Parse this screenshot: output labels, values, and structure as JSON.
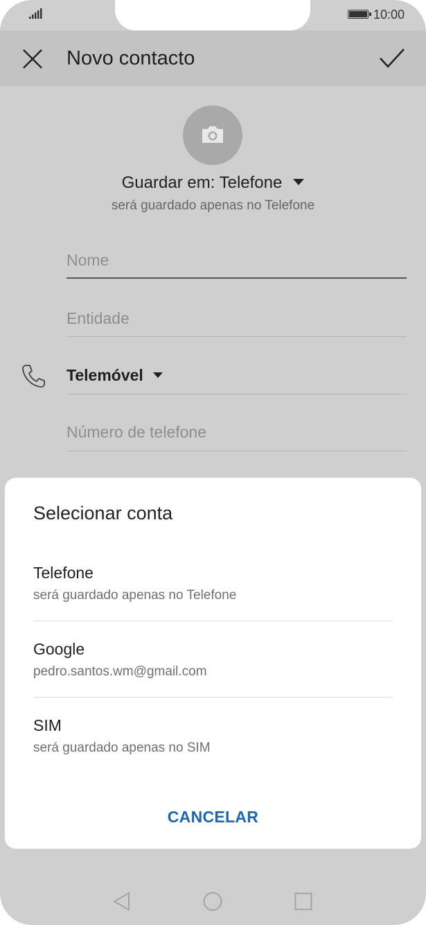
{
  "status": {
    "time": "10:00"
  },
  "appbar": {
    "title": "Novo contacto"
  },
  "save": {
    "label": "Guardar em: Telefone",
    "sub": "será guardado apenas no Telefone"
  },
  "fields": {
    "name_placeholder": "Nome",
    "entity_placeholder": "Entidade",
    "phone_type": "Telemóvel",
    "phone_placeholder": "Número de telefone"
  },
  "dialog": {
    "title": "Selecionar conta",
    "options": [
      {
        "title": "Telefone",
        "sub": "será guardado apenas no Telefone"
      },
      {
        "title": "Google",
        "sub": "pedro.santos.wm@gmail.com"
      },
      {
        "title": "SIM",
        "sub": "será guardado apenas no SIM"
      }
    ],
    "cancel": "CANCELAR"
  },
  "colors": {
    "accent": "#1a66b0",
    "scrim": "#cfcfcf",
    "sheet": "#ffffff"
  },
  "icons": [
    "signal-icon",
    "battery-icon",
    "close-icon",
    "check-icon",
    "camera-icon",
    "dropdown-arrow-icon",
    "phone-icon",
    "nav-back-icon",
    "nav-home-icon",
    "nav-recent-icon"
  ]
}
